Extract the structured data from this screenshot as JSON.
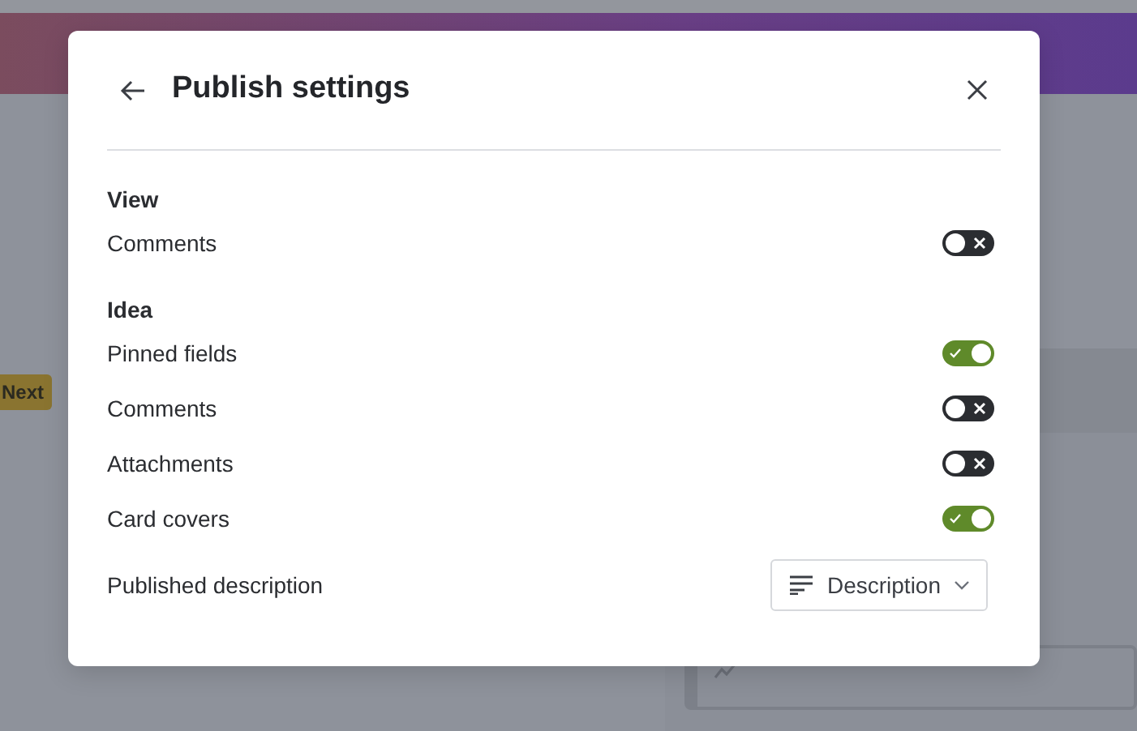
{
  "background": {
    "badge": "Next"
  },
  "dialog": {
    "title": "Publish settings",
    "sections": [
      {
        "heading": "View",
        "rows": [
          {
            "label": "Comments",
            "on": false
          }
        ]
      },
      {
        "heading": "Idea",
        "rows": [
          {
            "label": "Pinned fields",
            "on": true
          },
          {
            "label": "Comments",
            "on": false
          },
          {
            "label": "Attachments",
            "on": false
          },
          {
            "label": "Card covers",
            "on": true
          }
        ]
      }
    ],
    "select_row": {
      "label": "Published description",
      "value": "Description"
    }
  }
}
